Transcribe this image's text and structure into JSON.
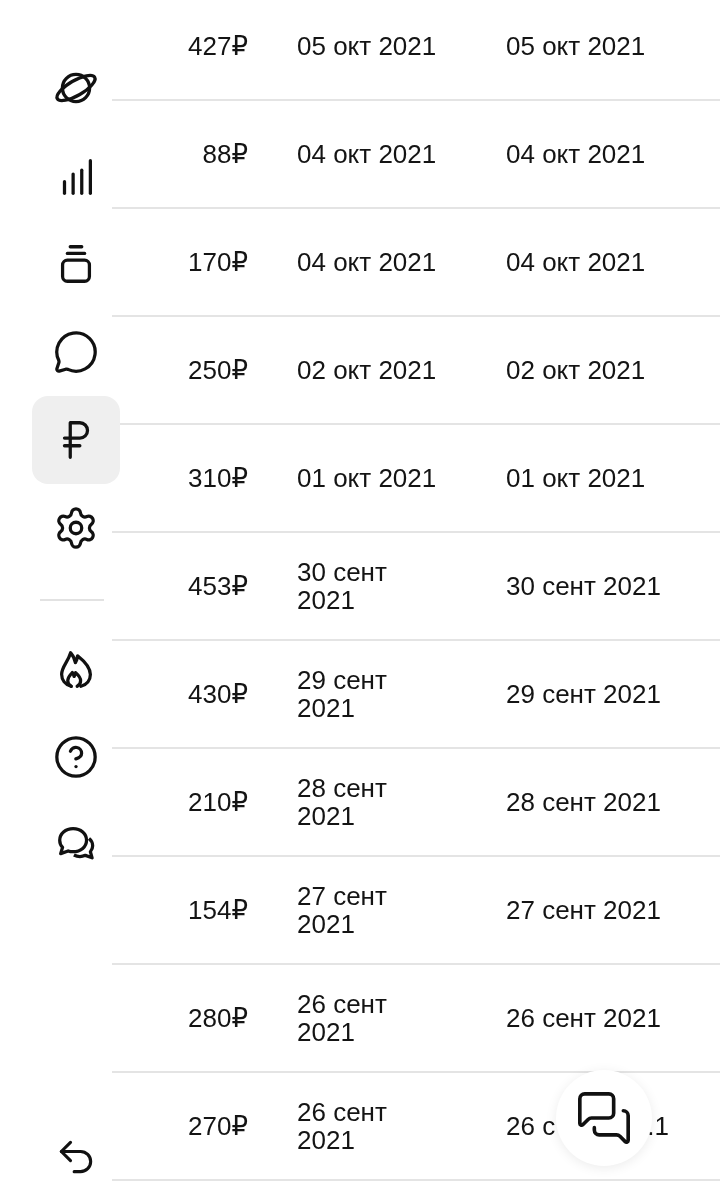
{
  "sidebar": {
    "top_items": [
      {
        "selected": false
      },
      {
        "selected": false
      },
      {
        "selected": false
      },
      {
        "selected": false
      },
      {
        "selected": true
      },
      {
        "selected": false
      }
    ],
    "bottom_items": [
      {
        "selected": false
      },
      {
        "selected": false
      },
      {
        "selected": false
      }
    ]
  },
  "table": {
    "rows": [
      {
        "column_1": "427₽",
        "column_2": "05 окт 2021",
        "column_3": "05 окт 2021"
      },
      {
        "column_1": "88₽",
        "column_2": "04 окт 2021",
        "column_3": "04 окт 2021"
      },
      {
        "column_1": "170₽",
        "column_2": "04 окт 2021",
        "column_3": "04 окт 2021"
      },
      {
        "column_1": "250₽",
        "column_2": "02 окт 2021",
        "column_3": "02 окт 2021"
      },
      {
        "column_1": "310₽",
        "column_2": "01 окт 2021",
        "column_3": "01 окт 2021"
      },
      {
        "column_1": "453₽",
        "column_2": "30 сент 2021",
        "column_3": "30 сент 2021"
      },
      {
        "column_1": "430₽",
        "column_2": "29 сент 2021",
        "column_3": "29 сент 2021"
      },
      {
        "column_1": "210₽",
        "column_2": "28 сент 2021",
        "column_3": "28 сент 2021"
      },
      {
        "column_1": "154₽",
        "column_2": "27 сент 2021",
        "column_3": "27 сент 2021"
      },
      {
        "column_1": "280₽",
        "column_2": "26 сент 2021",
        "column_3": "26 сент 2021"
      },
      {
        "column_1": "270₽",
        "column_2": "26 сент 2021",
        "column_3": [
          "26 с",
          ".1"
        ]
      }
    ]
  }
}
